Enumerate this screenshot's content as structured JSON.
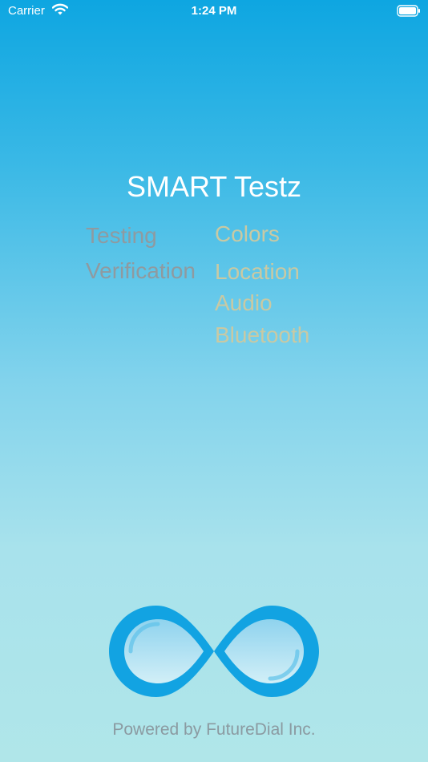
{
  "status_bar": {
    "carrier": "Carrier",
    "time": "1:24 PM",
    "icons": [
      "wifi-icon",
      "battery-icon"
    ]
  },
  "splash": {
    "title": "SMART Testz",
    "left_words": [
      "Testing",
      "Verification"
    ],
    "right_words": [
      "Colors",
      "Location",
      "Audio",
      "Bluetooth"
    ],
    "logo": "infinity-logo",
    "footer": "Powered by FutureDial Inc."
  },
  "colors": {
    "background_top": "#0ea6e1",
    "background_bottom": "#b0e6e9",
    "title": "#ffffff",
    "left_words": "#8f9aa0",
    "right_words": "#c9c9a3",
    "logo": "#12a3e2",
    "footer": "#8b9aa1"
  }
}
